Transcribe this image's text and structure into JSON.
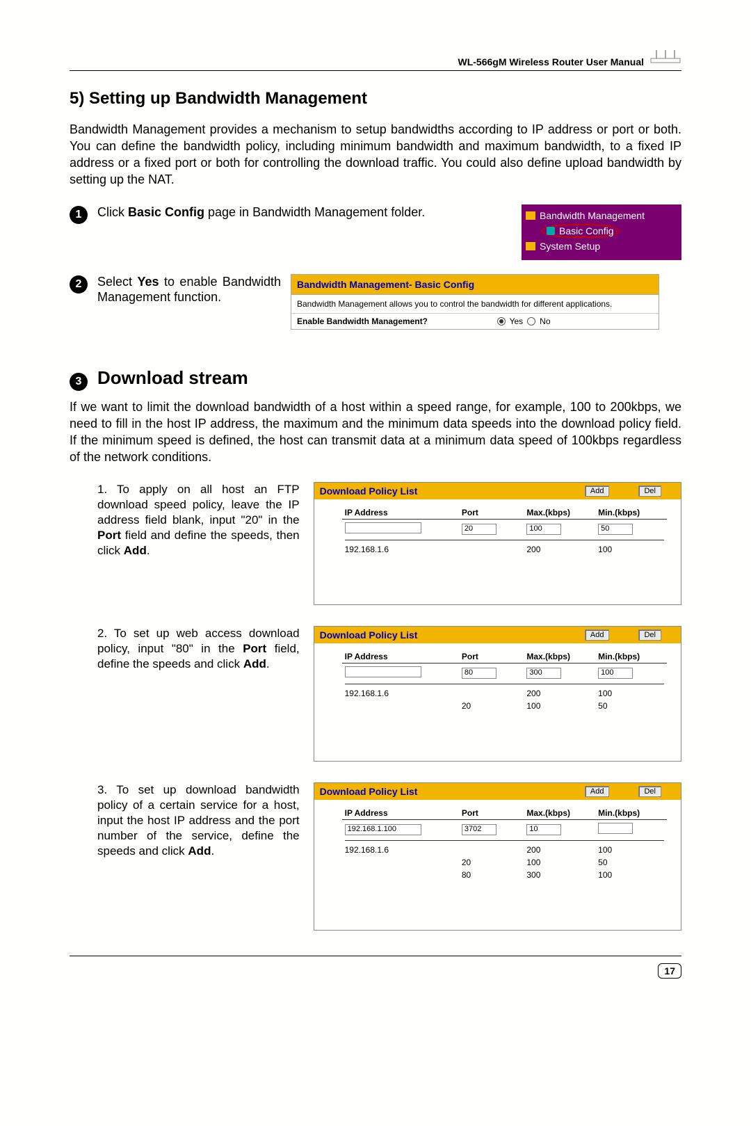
{
  "header": {
    "manual_title": "WL-566gM Wireless Router User Manual"
  },
  "section": {
    "title": "5) Setting up Bandwidth Management",
    "intro": "Bandwidth Management provides a mechanism to setup bandwidths according to IP address or port or both. You can define the bandwidth policy, including minimum bandwidth and maximum bandwidth, to a fixed IP address or a fixed port or both for controlling the download traffic. You could also define upload bandwidth by setting up the NAT."
  },
  "step1": {
    "text_pre": "Click ",
    "text_bold": "Basic Config",
    "text_post": " page in Bandwidth Management folder.",
    "nav": {
      "item1": "Bandwidth Management",
      "item2": "Basic Config",
      "item3": "System Setup"
    }
  },
  "step2": {
    "text_pre": "Select ",
    "text_bold": "Yes",
    "text_post": " to enable Bandwidth Management function.",
    "box": {
      "title": "Bandwidth Management- Basic Config",
      "desc": "Bandwidth Management allows you to control the bandwidth for different applications.",
      "label": "Enable Bandwidth Management?",
      "opt_yes": "Yes",
      "opt_no": "No"
    }
  },
  "step3": {
    "heading": "Download stream",
    "intro": "If we want to limit the download bandwidth of a host within a speed range, for example, 100 to 200kbps, we need to fill in the host IP address, the maximum and the minimum data speeds into the download policy field. If the minimum speed is defined, the host can transmit data at a minimum data speed of 100kbps regardless of the network conditions."
  },
  "policy_labels": {
    "title": "Download Policy List",
    "btn_add": "Add",
    "btn_del": "Del",
    "col_ip": "IP Address",
    "col_port": "Port",
    "col_max": "Max.(kbps)",
    "col_min": "Min.(kbps)"
  },
  "item1": {
    "text_pre": "1. To apply on all host an FTP download speed policy, leave the IP address field blank, input \"20\" in the ",
    "bold1": "Port",
    "text_mid": " field and define the speeds, then click ",
    "bold2": "Add",
    "text_end": ".",
    "input": {
      "ip": "",
      "port": "20",
      "max": "100",
      "min": "50"
    },
    "rows": [
      {
        "ip": "192.168.1.6",
        "port": "",
        "max": "200",
        "min": "100"
      }
    ]
  },
  "item2": {
    "text_pre": "2. To set up web access download policy, input \"80\" in the ",
    "bold1": "Port",
    "text_mid": " field, define the speeds and click ",
    "bold2": "Add",
    "text_end": ".",
    "input": {
      "ip": "",
      "port": "80",
      "max": "300",
      "min": "100"
    },
    "rows": [
      {
        "ip": "192.168.1.6",
        "port": "",
        "max": "200",
        "min": "100"
      },
      {
        "ip": "",
        "port": "20",
        "max": "100",
        "min": "50"
      }
    ]
  },
  "item3": {
    "text_pre": "3. To set up download bandwidth policy of a certain service for a host, input the host IP address and the port number of the service, define the speeds and click ",
    "bold1": "Add",
    "text_end": ".",
    "input": {
      "ip": "192.168.1.100",
      "port": "3702",
      "max": "10",
      "min": ""
    },
    "rows": [
      {
        "ip": "192.168.1.6",
        "port": "",
        "max": "200",
        "min": "100"
      },
      {
        "ip": "",
        "port": "20",
        "max": "100",
        "min": "50"
      },
      {
        "ip": "",
        "port": "80",
        "max": "300",
        "min": "100"
      }
    ]
  },
  "page_number": "17"
}
